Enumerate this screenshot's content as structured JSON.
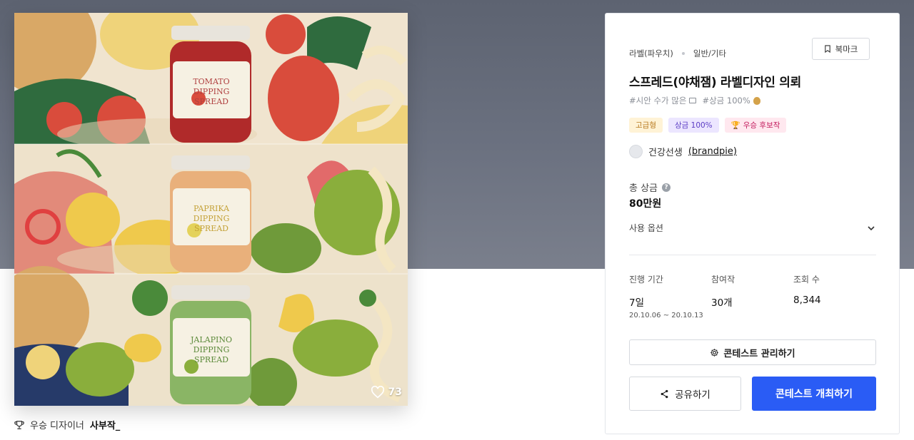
{
  "artwork": {
    "like_count": "73",
    "jar_labels": [
      {
        "line1": "TOMATO",
        "line2": "DIPPING",
        "line3": "SPREAD"
      },
      {
        "line1": "PAPRIKA",
        "line2": "DIPPING",
        "line3": "SPREAD"
      },
      {
        "line1": "JALAPINO",
        "line2": "DIPPING",
        "line3": "SPREAD"
      }
    ]
  },
  "winner": {
    "prefix": "우승 디자이너",
    "name": "사부작_"
  },
  "panel": {
    "category": "라벨(파우치)",
    "subcategory": "일반/기타",
    "bookmark_label": "북마크",
    "title": "스프레드(야채잼) 라벨디자인 의뢰",
    "tags_text": "#시안 수가 많은",
    "tags_text2": "#상금 100%",
    "badges": {
      "premium": "고급형",
      "prize": "상금 100%",
      "candidate": "우승 후보작"
    },
    "host_name": "건강선생",
    "host_handle": "(brandpie)",
    "prize_label": "총 상금",
    "prize_value": "80만원",
    "usage_label": "사용 옵션",
    "stats": {
      "duration_label": "진행 기간",
      "duration_value": "7일",
      "duration_range": "20.10.06 ~ 20.10.13",
      "entries_label": "참여작",
      "entries_value": "30개",
      "views_label": "조회 수",
      "views_value": "8,344"
    },
    "manage_label": "콘테스트 관리하기",
    "share_label": "공유하기",
    "open_label": "콘테스트 개최하기"
  },
  "colors": {
    "primary": "#2a5cf5",
    "hero_bg": "#5d6371",
    "badge_premium": "#fff3d6",
    "badge_prize": "#ece6ff",
    "badge_candidate": "#ffe8ef"
  }
}
